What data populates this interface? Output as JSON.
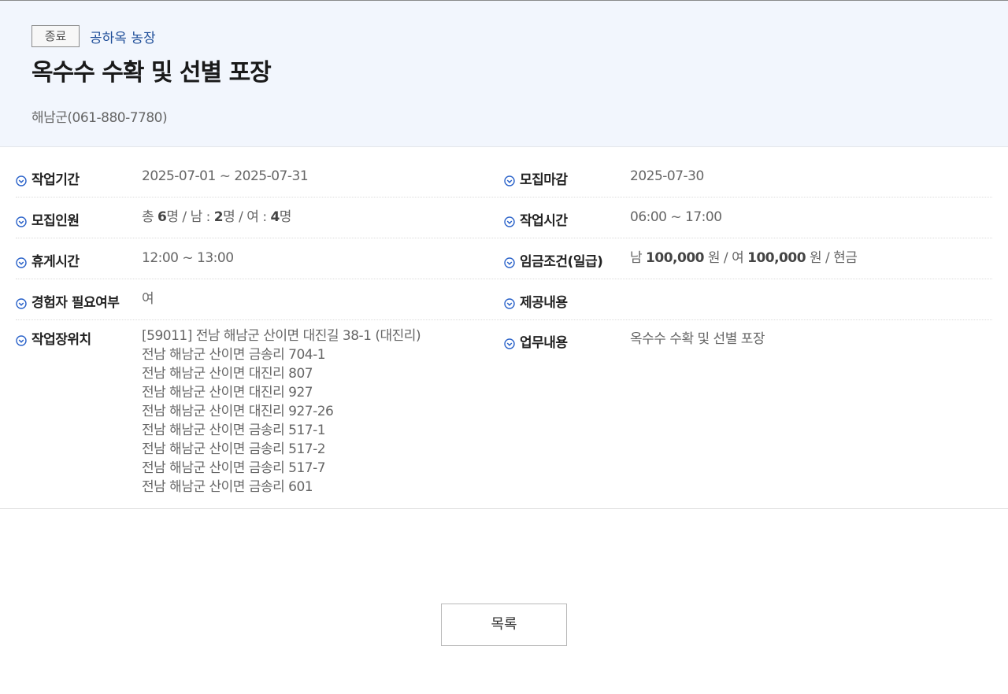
{
  "header": {
    "status": "종료",
    "farm": "공하옥 농장",
    "title": "옥수수 수확 및 선별 포장",
    "contact": "해남군(061-880-7780)"
  },
  "icons": {
    "check": "circle-chevron-down-icon",
    "accent": "#2a62c9"
  },
  "details": {
    "work_period": {
      "label": "작업기간",
      "value": "2025-07-01 ~ 2025-07-31"
    },
    "recruit_deadline": {
      "label": "모집마감",
      "value": "2025-07-30"
    },
    "recruit_count": {
      "label": "모집인원",
      "total_prefix": "총 ",
      "total": "6",
      "total_unit": "명 / 남 : ",
      "male": "2",
      "male_unit": "명 / 여 : ",
      "female": "4",
      "female_unit": "명"
    },
    "work_hours": {
      "label": "작업시간",
      "value": "06:00 ~ 17:00"
    },
    "break_time": {
      "label": "휴게시간",
      "value": "12:00 ~ 13:00"
    },
    "wage": {
      "label": "임금조건(일급)",
      "male_prefix": "남 ",
      "male": "100,000",
      "male_unit": " 원 / 여 ",
      "female": "100,000",
      "female_unit": " 원 / 현금"
    },
    "experience": {
      "label": "경험자 필요여부",
      "value": "여"
    },
    "provided": {
      "label": "제공내용",
      "value": ""
    },
    "location": {
      "label": "작업장위치",
      "lines": [
        "[59011] 전남 해남군 산이면 대진길 38-1 (대진리)",
        "전남 해남군 산이면 금송리 704-1",
        "전남 해남군 산이면 대진리 807",
        "전남 해남군 산이면 대진리 927",
        "전남 해남군 산이면 대진리 927-26",
        "전남 해남군 산이면 금송리 517-1",
        "전남 해남군 산이면 금송리 517-2",
        "전남 해남군 산이면 금송리 517-7",
        "전남 해남군 산이면 금송리 601"
      ]
    },
    "job_description": {
      "label": "업무내용",
      "value": "옥수수 수확 및 선별 포장"
    }
  },
  "footer": {
    "list_button": "목록"
  }
}
